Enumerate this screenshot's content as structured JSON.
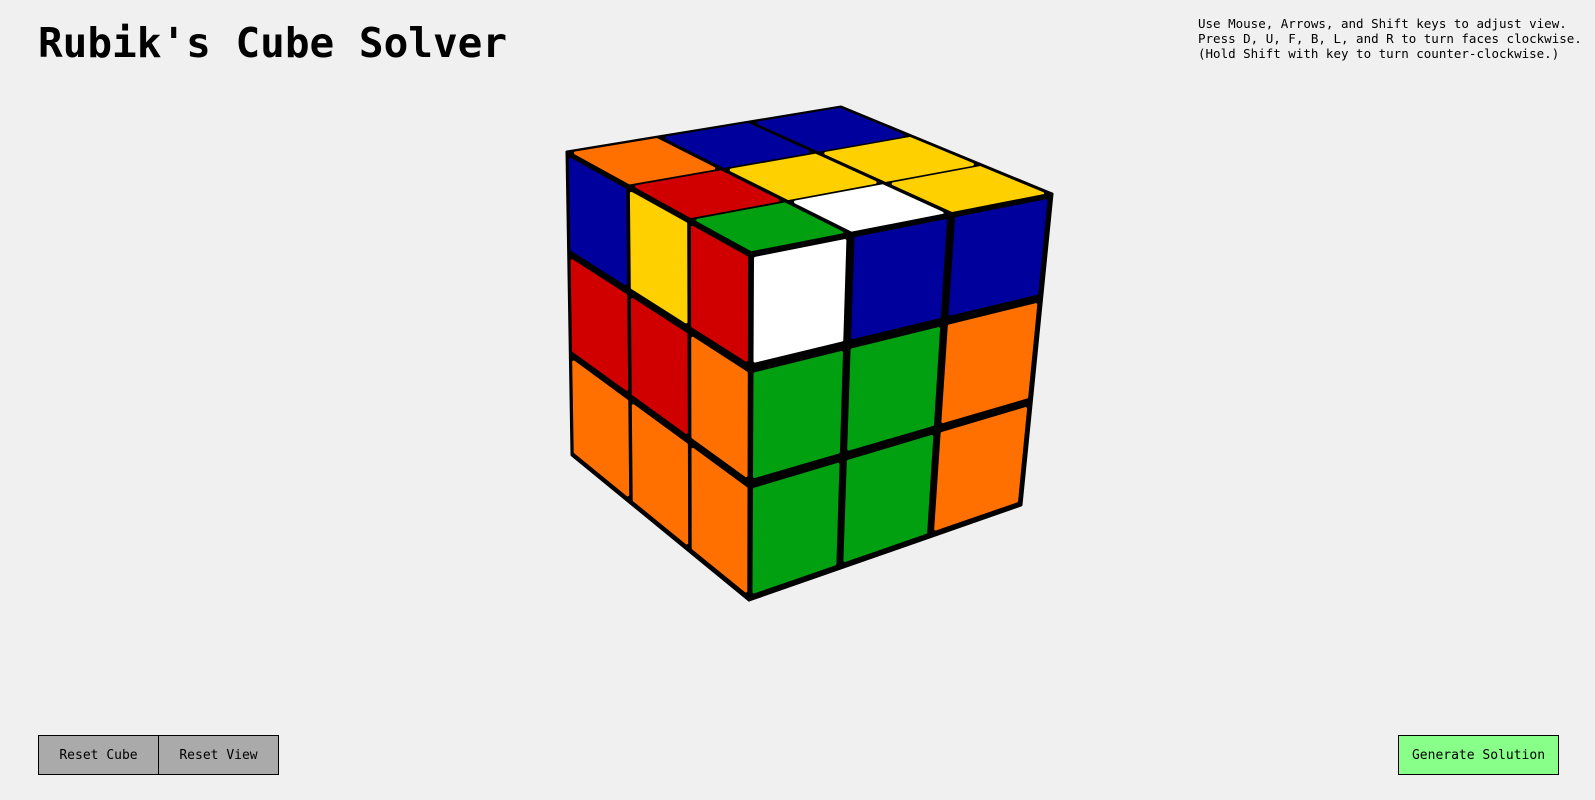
{
  "header": {
    "title": "Rubik's Cube Solver"
  },
  "instructions": {
    "lines": [
      "Use Mouse, Arrows, and Shift keys to adjust view.",
      "Press D, U, F, B, L, and R to turn faces clockwise.",
      "(Hold Shift with key to turn counter-clockwise.)"
    ]
  },
  "cube": {
    "colors": {
      "W": "#ffffff",
      "Y": "#ffd000",
      "R": "#d00000",
      "O": "#ff7000",
      "G": "#00a010",
      "B": "#00009c"
    },
    "faces": {
      "top": [
        [
          "O",
          "B",
          "B"
        ],
        [
          "R",
          "Y",
          "Y"
        ],
        [
          "G",
          "W",
          "Y"
        ]
      ],
      "left": [
        [
          "B",
          "Y",
          "R"
        ],
        [
          "R",
          "R",
          "O"
        ],
        [
          "O",
          "O",
          "O"
        ]
      ],
      "front": [
        [
          "W",
          "B",
          "B"
        ],
        [
          "G",
          "G",
          "O"
        ],
        [
          "G",
          "G",
          "O"
        ]
      ]
    }
  },
  "buttons": {
    "reset_cube": "Reset Cube",
    "reset_view": "Reset View",
    "generate_solution": "Generate Solution"
  }
}
